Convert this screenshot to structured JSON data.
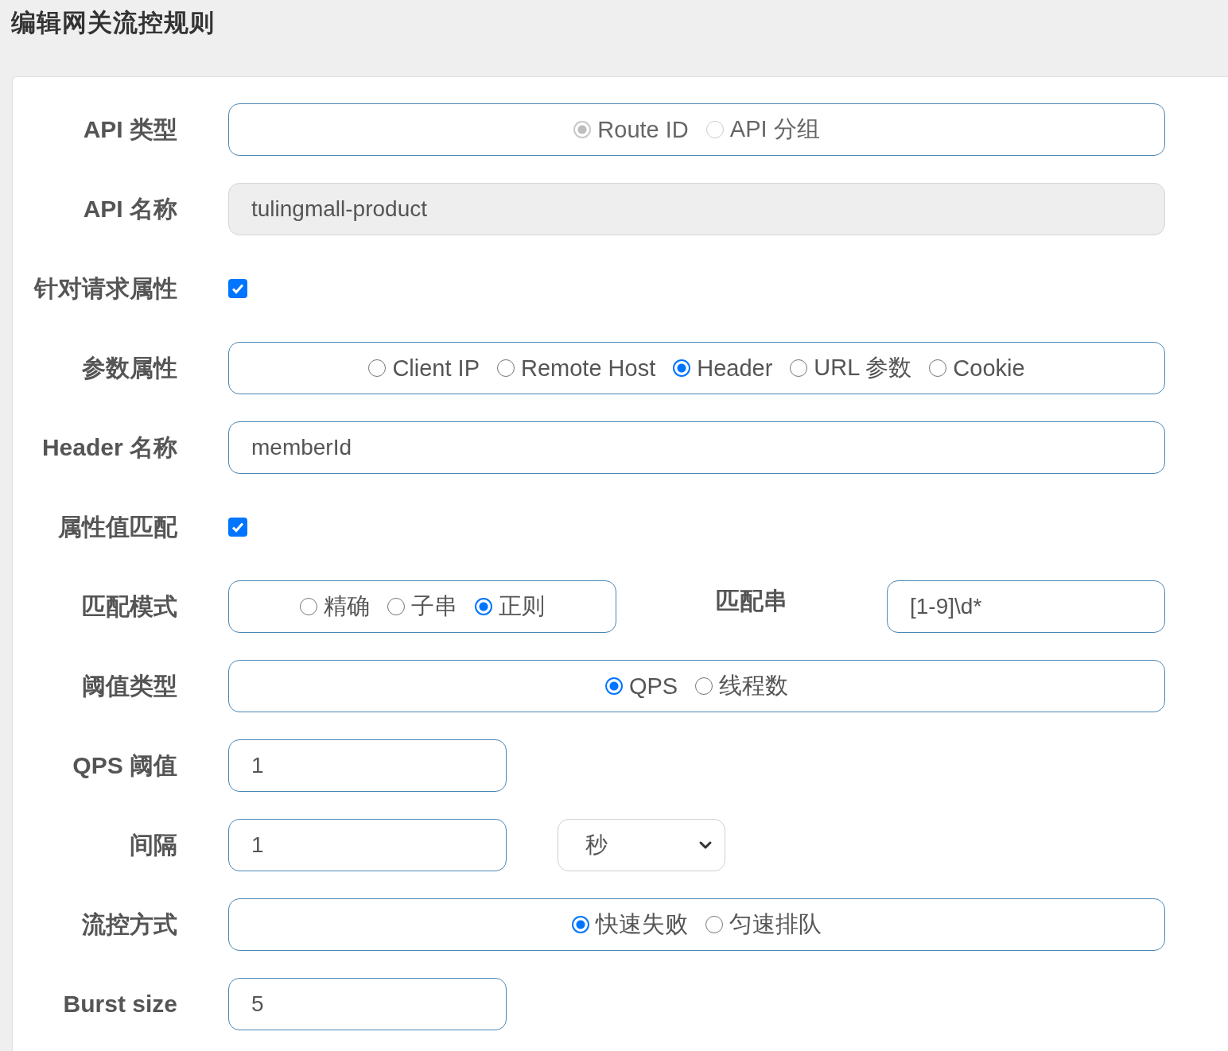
{
  "page": {
    "title": "编辑网关流控规则"
  },
  "fields": [
    {
      "kind": "radio",
      "label": "API 类型",
      "disabled": true,
      "options": [
        {
          "label": "Route ID",
          "selected": true
        },
        {
          "label": "API 分组",
          "selected": false
        }
      ]
    },
    {
      "kind": "text",
      "label": "API 名称",
      "value": "tulingmall-product",
      "disabled": true
    },
    {
      "kind": "checkbox",
      "label": "针对请求属性",
      "checked": true
    },
    {
      "kind": "radio",
      "label": "参数属性",
      "disabled": false,
      "options": [
        {
          "label": "Client IP",
          "selected": false
        },
        {
          "label": "Remote Host",
          "selected": false
        },
        {
          "label": "Header",
          "selected": true
        },
        {
          "label": "URL 参数",
          "selected": false
        },
        {
          "label": "Cookie",
          "selected": false
        }
      ]
    },
    {
      "kind": "text",
      "label": "Header 名称",
      "value": "memberId",
      "disabled": false
    },
    {
      "kind": "checkbox",
      "label": "属性值匹配",
      "checked": true
    },
    {
      "kind": "match",
      "label": "匹配模式",
      "options": [
        {
          "label": "精确",
          "selected": false
        },
        {
          "label": "子串",
          "selected": false
        },
        {
          "label": "正则",
          "selected": true
        }
      ],
      "pattern_label": "匹配串",
      "pattern_value": "[1-9]\\d*"
    },
    {
      "kind": "radio",
      "label": "阈值类型",
      "disabled": false,
      "options": [
        {
          "label": "QPS",
          "selected": true
        },
        {
          "label": "线程数",
          "selected": false
        }
      ]
    },
    {
      "kind": "short",
      "label": "QPS 阈值",
      "value": "1"
    },
    {
      "kind": "interval",
      "label": "间隔",
      "value": "1",
      "unit": "秒"
    },
    {
      "kind": "radio",
      "label": "流控方式",
      "disabled": false,
      "options": [
        {
          "label": "快速失败",
          "selected": true
        },
        {
          "label": "匀速排队",
          "selected": false
        }
      ]
    },
    {
      "kind": "short",
      "label": "Burst size",
      "value": "5"
    }
  ]
}
